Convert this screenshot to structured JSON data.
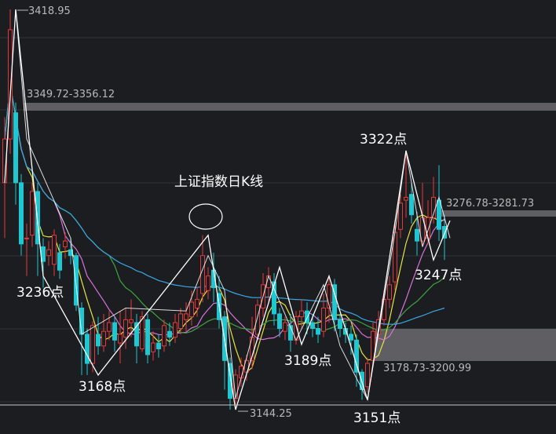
{
  "chart_data": {
    "type": "candlestick",
    "title": "上证指数日K线",
    "ylim": [
      3130,
      3430
    ],
    "price_levels": {
      "high_label": "3418.95",
      "low_label": "3144.25"
    },
    "zones": [
      {
        "label": "3349.72-3356.12",
        "low": 3349.72,
        "high": 3356.12,
        "color": "#6b6b6e"
      },
      {
        "label": "3276.78-3281.73",
        "low": 3276.78,
        "high": 3281.73,
        "color": "#6b6b6e"
      },
      {
        "label": "3178.73-3200.99",
        "low": 3178.73,
        "high": 3200.99,
        "color": "#6b6b6e"
      }
    ],
    "wave_labels": [
      "3236点",
      "3168点",
      "3189点",
      "3151点",
      "3322点",
      "3247点"
    ],
    "candles": [
      [
        3300,
        3330,
        3262,
        3345
      ],
      [
        3330,
        3405,
        3320,
        3418.95
      ],
      [
        3348,
        3300,
        3285,
        3355
      ],
      [
        3300,
        3258,
        3250,
        3306
      ],
      [
        3262,
        3262,
        3236,
        3272
      ],
      [
        3264,
        3294,
        3256,
        3300
      ],
      [
        3294,
        3258,
        3236,
        3300
      ],
      [
        3256,
        3246,
        3228,
        3262
      ],
      [
        3250,
        3254,
        3243,
        3260
      ],
      [
        3244,
        3264,
        3236,
        3268
      ],
      [
        3252,
        3240,
        3234,
        3258
      ],
      [
        3256,
        3260,
        3248,
        3266
      ],
      [
        3254,
        3250,
        3244,
        3262
      ],
      [
        3250,
        3216,
        3212,
        3252
      ],
      [
        3214,
        3196,
        3168,
        3218
      ],
      [
        3196,
        3176,
        3168,
        3200
      ],
      [
        3176,
        3202,
        3170,
        3205
      ],
      [
        3196,
        3188,
        3182,
        3208
      ],
      [
        3188,
        3198,
        3184,
        3210
      ],
      [
        3198,
        3204,
        3192,
        3212
      ],
      [
        3204,
        3192,
        3184,
        3208
      ],
      [
        3190,
        3196,
        3176,
        3212
      ],
      [
        3194,
        3206,
        3186,
        3214
      ],
      [
        3204,
        3206,
        3194,
        3220
      ],
      [
        3204,
        3188,
        3176,
        3210
      ],
      [
        3186,
        3208,
        3184,
        3212
      ],
      [
        3206,
        3182,
        3176,
        3210
      ],
      [
        3184,
        3190,
        3178,
        3198
      ],
      [
        3190,
        3186,
        3180,
        3196
      ],
      [
        3188,
        3202,
        3184,
        3206
      ],
      [
        3198,
        3194,
        3188,
        3204
      ],
      [
        3194,
        3204,
        3190,
        3210
      ],
      [
        3200,
        3210,
        3196,
        3214
      ],
      [
        3206,
        3210,
        3198,
        3218
      ],
      [
        3208,
        3218,
        3202,
        3226
      ],
      [
        3214,
        3220,
        3208,
        3228
      ],
      [
        3224,
        3250,
        3218,
        3264
      ],
      [
        3226,
        3236,
        3220,
        3242
      ],
      [
        3240,
        3228,
        3218,
        3252
      ],
      [
        3224,
        3206,
        3200,
        3236
      ],
      [
        3208,
        3178,
        3158,
        3212
      ],
      [
        3176,
        3152,
        3144.25,
        3180
      ],
      [
        3152,
        3168,
        3148,
        3172
      ],
      [
        3166,
        3174,
        3160,
        3180
      ],
      [
        3170,
        3178,
        3164,
        3182
      ],
      [
        3178,
        3194,
        3172,
        3208
      ],
      [
        3196,
        3216,
        3192,
        3220
      ],
      [
        3214,
        3230,
        3208,
        3238
      ],
      [
        3228,
        3236,
        3218,
        3242
      ],
      [
        3232,
        3210,
        3202,
        3238
      ],
      [
        3210,
        3200,
        3194,
        3214
      ],
      [
        3198,
        3204,
        3192,
        3208
      ],
      [
        3202,
        3192,
        3184,
        3210
      ],
      [
        3192,
        3208,
        3189,
        3212
      ],
      [
        3208,
        3212,
        3200,
        3220
      ],
      [
        3212,
        3204,
        3196,
        3218
      ],
      [
        3204,
        3200,
        3194,
        3210
      ],
      [
        3200,
        3196,
        3190,
        3208
      ],
      [
        3198,
        3214,
        3194,
        3224
      ],
      [
        3214,
        3230,
        3204,
        3236
      ],
      [
        3230,
        3206,
        3198,
        3234
      ],
      [
        3206,
        3200,
        3194,
        3210
      ],
      [
        3200,
        3196,
        3190,
        3204
      ],
      [
        3196,
        3192,
        3182,
        3202
      ],
      [
        3192,
        3170,
        3160,
        3196
      ],
      [
        3170,
        3158,
        3151,
        3172
      ],
      [
        3160,
        3176,
        3156,
        3180
      ],
      [
        3178,
        3198,
        3174,
        3204
      ],
      [
        3196,
        3206,
        3192,
        3212
      ],
      [
        3206,
        3220,
        3202,
        3226
      ],
      [
        3220,
        3230,
        3214,
        3236
      ],
      [
        3232,
        3266,
        3226,
        3272
      ],
      [
        3268,
        3286,
        3262,
        3292
      ],
      [
        3288,
        3290,
        3276,
        3322
      ],
      [
        3292,
        3278,
        3272,
        3300
      ],
      [
        3268,
        3260,
        3250,
        3280
      ],
      [
        3260,
        3276,
        3256,
        3300
      ],
      [
        3262,
        3276,
        3258,
        3288
      ],
      [
        3276,
        3290,
        3272,
        3304
      ],
      [
        3288,
        3268,
        3260,
        3312
      ],
      [
        3270,
        3262,
        3247,
        3278
      ]
    ],
    "moving_averages": [
      {
        "color": "#e6e63a"
      },
      {
        "color": "#d873d8"
      },
      {
        "color": "#3fa33f"
      },
      {
        "color": "#39a7e6"
      }
    ]
  }
}
